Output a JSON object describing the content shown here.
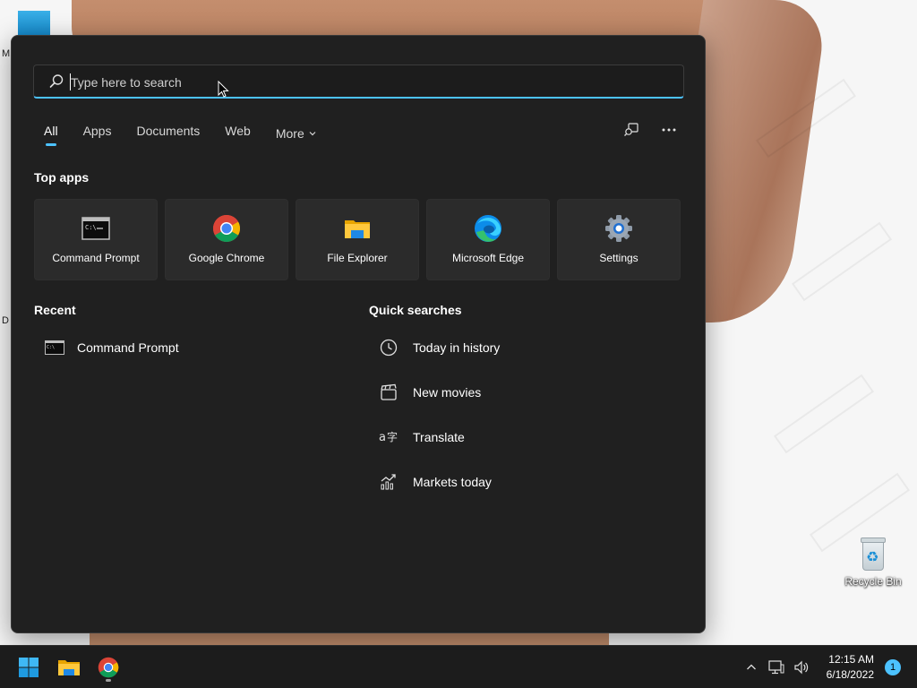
{
  "search": {
    "placeholder": "Type here to search"
  },
  "tabs": [
    {
      "label": "All",
      "active": true
    },
    {
      "label": "Apps",
      "active": false
    },
    {
      "label": "Documents",
      "active": false
    },
    {
      "label": "Web",
      "active": false
    },
    {
      "label": "More",
      "active": false
    }
  ],
  "toolbar_icons": [
    "search-device-icon",
    "more-options-icon"
  ],
  "top_apps": {
    "title": "Top apps",
    "items": [
      {
        "label": "Command Prompt",
        "icon": "command-prompt-icon"
      },
      {
        "label": "Google Chrome",
        "icon": "chrome-icon"
      },
      {
        "label": "File Explorer",
        "icon": "file-explorer-icon"
      },
      {
        "label": "Microsoft Edge",
        "icon": "edge-icon"
      },
      {
        "label": "Settings",
        "icon": "settings-gear-icon"
      }
    ]
  },
  "recent": {
    "title": "Recent",
    "items": [
      {
        "label": "Command Prompt",
        "icon": "command-prompt-icon"
      }
    ]
  },
  "quick_searches": {
    "title": "Quick searches",
    "items": [
      {
        "label": "Today in history",
        "icon": "clock-icon"
      },
      {
        "label": "New movies",
        "icon": "clapperboard-icon"
      },
      {
        "label": "Translate",
        "icon": "translate-icon"
      },
      {
        "label": "Markets today",
        "icon": "chart-up-icon"
      }
    ]
  },
  "desktop": {
    "recycle_bin_label": "Recycle Bin",
    "edge_letters": [
      "M",
      "D"
    ]
  },
  "taskbar": {
    "time": "12:15 AM",
    "date": "6/18/2022",
    "notification_count": "1"
  },
  "colors": {
    "accent": "#4cc2ff",
    "panel_bg": "#202020",
    "tile_bg": "#2b2b2b",
    "taskbar_bg": "#1c1c1c"
  }
}
